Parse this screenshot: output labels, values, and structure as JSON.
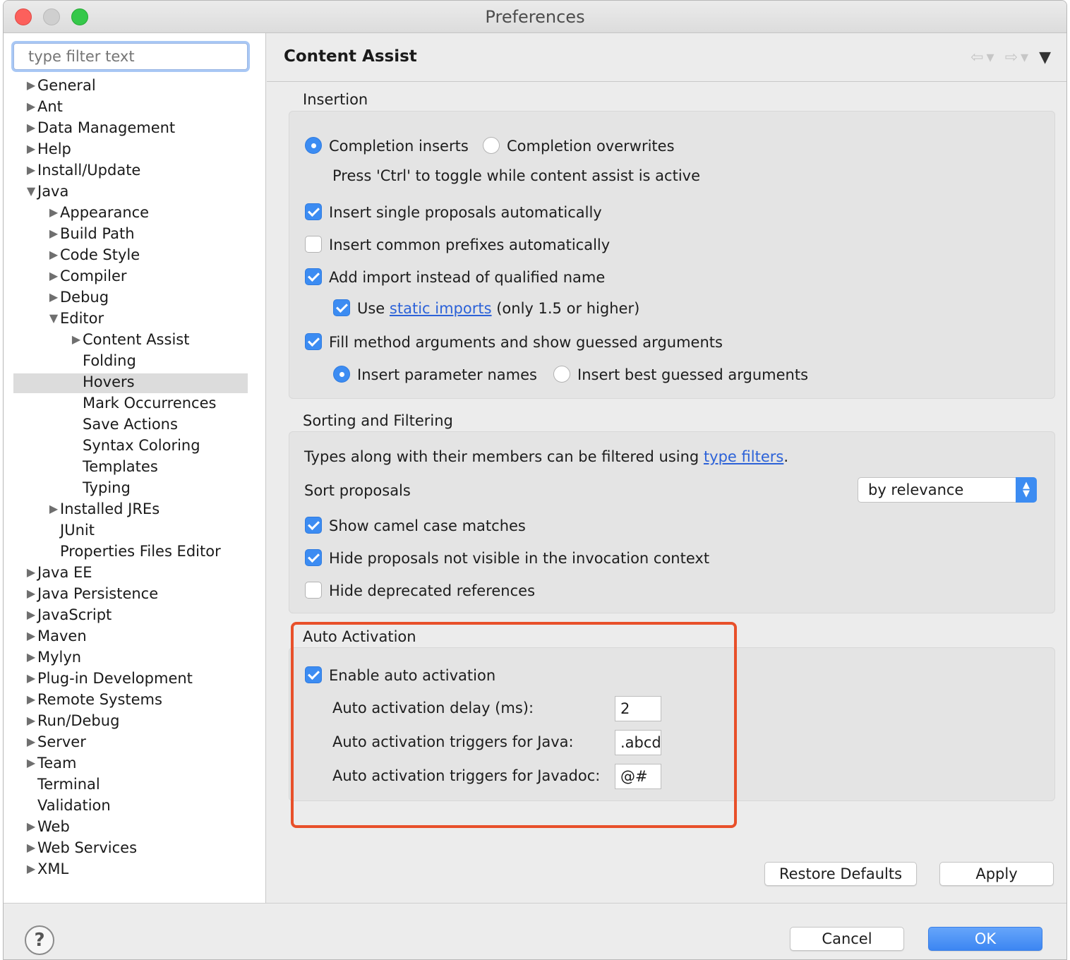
{
  "window": {
    "title": "Preferences"
  },
  "filter": {
    "placeholder": "type filter text"
  },
  "tree": [
    {
      "label": "General",
      "expanded": false
    },
    {
      "label": "Ant",
      "expanded": false
    },
    {
      "label": "Data Management",
      "expanded": false
    },
    {
      "label": "Help",
      "expanded": false
    },
    {
      "label": "Install/Update",
      "expanded": false
    },
    {
      "label": "Java",
      "expanded": true
    },
    {
      "label": "Appearance",
      "expanded": false
    },
    {
      "label": "Build Path",
      "expanded": false
    },
    {
      "label": "Code Style",
      "expanded": false
    },
    {
      "label": "Compiler",
      "expanded": false
    },
    {
      "label": "Debug",
      "expanded": false
    },
    {
      "label": "Editor",
      "expanded": true
    },
    {
      "label": "Content Assist",
      "expanded": false,
      "selected": true
    },
    {
      "label": "Folding"
    },
    {
      "label": "Hovers"
    },
    {
      "label": "Mark Occurrences"
    },
    {
      "label": "Save Actions"
    },
    {
      "label": "Syntax Coloring"
    },
    {
      "label": "Templates"
    },
    {
      "label": "Typing"
    },
    {
      "label": "Installed JREs",
      "expanded": false
    },
    {
      "label": "JUnit"
    },
    {
      "label": "Properties Files Editor"
    },
    {
      "label": "Java EE",
      "expanded": false
    },
    {
      "label": "Java Persistence",
      "expanded": false
    },
    {
      "label": "JavaScript",
      "expanded": false
    },
    {
      "label": "Maven",
      "expanded": false
    },
    {
      "label": "Mylyn",
      "expanded": false
    },
    {
      "label": "Plug-in Development",
      "expanded": false
    },
    {
      "label": "Remote Systems",
      "expanded": false
    },
    {
      "label": "Run/Debug",
      "expanded": false
    },
    {
      "label": "Server",
      "expanded": false
    },
    {
      "label": "Team",
      "expanded": false
    },
    {
      "label": "Terminal"
    },
    {
      "label": "Validation"
    },
    {
      "label": "Web",
      "expanded": false
    },
    {
      "label": "Web Services",
      "expanded": false
    },
    {
      "label": "XML",
      "expanded": false
    }
  ],
  "page": {
    "title": "Content Assist"
  },
  "insertion": {
    "label": "Insertion",
    "completion_inserts": "Completion inserts",
    "completion_overwrites": "Completion overwrites",
    "toggle_hint": "Press 'Ctrl' to toggle while content assist is active",
    "single_proposals": "Insert single proposals automatically",
    "common_prefixes": "Insert common prefixes automatically",
    "add_import": "Add import instead of qualified name",
    "use_prefix": "Use",
    "static_imports": "static imports",
    "use_suffix": "(only 1.5 or higher)",
    "fill_method": "Fill method arguments and show guessed arguments",
    "param_names": "Insert parameter names",
    "best_guessed": "Insert best guessed arguments"
  },
  "sorting": {
    "label": "Sorting and Filtering",
    "types_text": "Types along with their members can be filtered using",
    "type_filters": "type filters",
    "period": ".",
    "sort_label": "Sort proposals",
    "sort_value": "by relevance",
    "camel_case": "Show camel case matches",
    "hide_not_visible": "Hide proposals not visible in the invocation context",
    "hide_deprecated": "Hide deprecated references"
  },
  "auto": {
    "label": "Auto Activation",
    "enable": "Enable auto activation",
    "delay_label": "Auto activation delay (ms):",
    "delay_value": "2",
    "java_label": "Auto activation triggers for Java:",
    "java_value": ".abcd",
    "javadoc_label": "Auto activation triggers for Javadoc:",
    "javadoc_value": "@#"
  },
  "buttons": {
    "restore": "Restore Defaults",
    "apply": "Apply",
    "cancel": "Cancel",
    "ok": "OK",
    "help": "?"
  },
  "icons": {
    "back": "back-arrow-icon",
    "forward": "forward-arrow-icon",
    "menu": "view-menu-icon"
  },
  "colors": {
    "accent": "#3c8cf2",
    "highlight": "#e8502a",
    "link": "#2c62d8"
  }
}
